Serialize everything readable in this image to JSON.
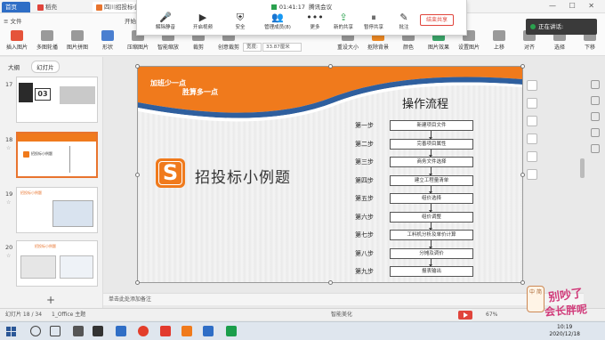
{
  "tabs": {
    "home": "首页",
    "doc1": "稻壳",
    "doc2": "四川招投标小例题"
  },
  "ribbon": {
    "file_menu": "≡ 文件",
    "start_label": "开始",
    "buttons": [
      {
        "label": "插入图片",
        "color": "#e5533a"
      },
      {
        "label": "多图轮播",
        "color": "#9a9a9a"
      },
      {
        "label": "图片拼图",
        "color": "#9a9a9a"
      },
      {
        "label": "形状",
        "color": "#4a7fd0"
      },
      {
        "label": "压缩图片",
        "color": "#9a9a9a"
      },
      {
        "label": "智能缩放",
        "color": "#9a9a9a"
      },
      {
        "label": "裁剪",
        "color": "#9a9a9a"
      },
      {
        "label": "创意裁剪",
        "color": "#9a9a9a"
      },
      {
        "label": "重设大小",
        "color": "#9a9a9a"
      },
      {
        "label": "抠除背景",
        "color": "#f08a24"
      },
      {
        "label": "颜色",
        "color": "#9a9a9a"
      },
      {
        "label": "图片效果",
        "color": "#3ca86b"
      },
      {
        "label": "设置图片",
        "color": "#9a9a9a"
      },
      {
        "label": "上移",
        "color": "#9a9a9a"
      },
      {
        "label": "对齐",
        "color": "#9a9a9a"
      },
      {
        "label": "选择",
        "color": "#9a9a9a"
      },
      {
        "label": "下移",
        "color": "#9a9a9a"
      }
    ],
    "width_label": "宽度:",
    "width_value": "33.87厘米"
  },
  "meeting": {
    "timer": "01:41:17",
    "app_name": "腾讯会议",
    "buttons": [
      {
        "icon": "mic-off-icon",
        "label": "解除静音"
      },
      {
        "icon": "video-icon",
        "label": "开启视频"
      },
      {
        "icon": "shield-icon",
        "label": "安全"
      },
      {
        "icon": "members-icon",
        "label": "管理成员(8)"
      },
      {
        "icon": "more-icon",
        "label": "更多"
      },
      {
        "icon": "share-icon",
        "label": "新的共享"
      },
      {
        "icon": "pause-icon",
        "label": "暂停共享"
      },
      {
        "icon": "annotate-icon",
        "label": "批注"
      }
    ],
    "end_share": "结束共享",
    "speaking": "正在讲话:"
  },
  "panel": {
    "tab_outline": "大纲",
    "tab_slides": "幻灯片",
    "slides": [
      {
        "num": "17",
        "title": ""
      },
      {
        "num": "18",
        "title": "招投标小例题"
      },
      {
        "num": "19",
        "title": "招投标小例题"
      },
      {
        "num": "20",
        "title": "招投标小例题"
      }
    ]
  },
  "slide": {
    "tagline1": "加班少一点",
    "tagline2": "胜算多一点",
    "logo_letter": "S",
    "title": "招投标小例题",
    "flow_title": "操作流程",
    "steps": [
      {
        "label": "第一步",
        "text": "新建项目文件"
      },
      {
        "label": "第二步",
        "text": "完善项目属性"
      },
      {
        "label": "第三步",
        "text": "商务文件选择"
      },
      {
        "label": "第四步",
        "text": "建立工程量清单"
      },
      {
        "label": "第五步",
        "text": "组价选择"
      },
      {
        "label": "第六步",
        "text": "组价调整"
      },
      {
        "label": "第七步",
        "text": "工料机分析及单价计算"
      },
      {
        "label": "第八步",
        "text": "分摊及调价"
      },
      {
        "label": "第九步",
        "text": "报表输出"
      }
    ],
    "colors": {
      "orange": "#f07a1c",
      "blue": "#2f5f9e"
    }
  },
  "notes_placeholder": "单击此处添加备注",
  "status": {
    "slide_count": "幻灯片 18 / 34",
    "theme": "1_Office 主题",
    "smart": "智能美化",
    "zoom": "67%"
  },
  "sticker": {
    "tag": "中 简",
    "line1": "别吵了",
    "line2": "会长胖呢"
  },
  "taskbar": {
    "time": "10:19",
    "date": "2020/12/18"
  }
}
